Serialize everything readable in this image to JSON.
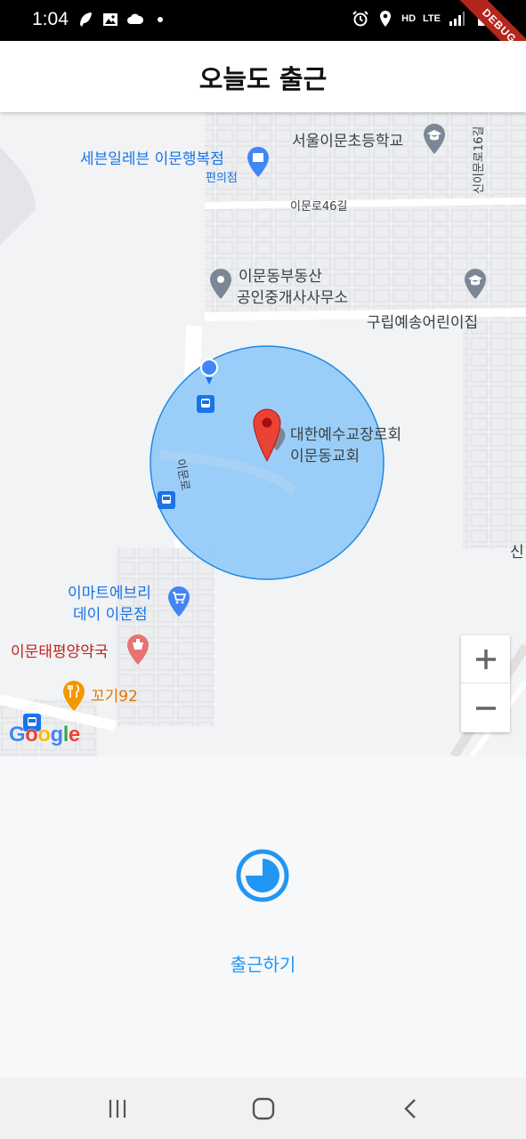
{
  "status_bar": {
    "time": "1:04",
    "left_icons": [
      "feather-icon",
      "image-icon",
      "cloud-icon",
      "dot-icon"
    ],
    "right_icons": [
      "alarm-icon",
      "location-icon",
      "hd-voice-icon",
      "lte-signal-icon",
      "signal-icon",
      "battery-icon"
    ],
    "network_hd": "HD",
    "network_lte": "LTE",
    "debug_ribbon": "DEBUG"
  },
  "app_bar": {
    "title": "오늘도 출근"
  },
  "map": {
    "labels": {
      "seven_eleven": "세븐일레븐 이문행복점",
      "seven_eleven_type": "편의점",
      "school": "서울이문초등학교",
      "road_46": "이문로46길",
      "road_16_side": "신이문로16길",
      "realestate_line1": "이문동부동산",
      "realestate_line2": "공인중개사사무소",
      "kindergarten": "구립예송어린이집",
      "church_line1": "대한예수교장로회",
      "church_line2": "이문동교회",
      "imun_road": "이문로",
      "emart_line1": "이마트에브리",
      "emart_line2": "데이 이문점",
      "pharmacy": "이문태평양약국",
      "restaurant": "꼬기92",
      "edge_shin": "신"
    },
    "google_logo": "Google",
    "zoom_in": "+",
    "zoom_out": "−",
    "geofence_color": "#90caf9",
    "marker_color": "#ea4335"
  },
  "checkin": {
    "icon": "clock-progress-icon",
    "label": "출근하기",
    "accent": "#2196f3"
  },
  "nav_bar": {
    "recents_icon": "recents-icon",
    "home_icon": "home-icon",
    "back_icon": "back-icon"
  }
}
